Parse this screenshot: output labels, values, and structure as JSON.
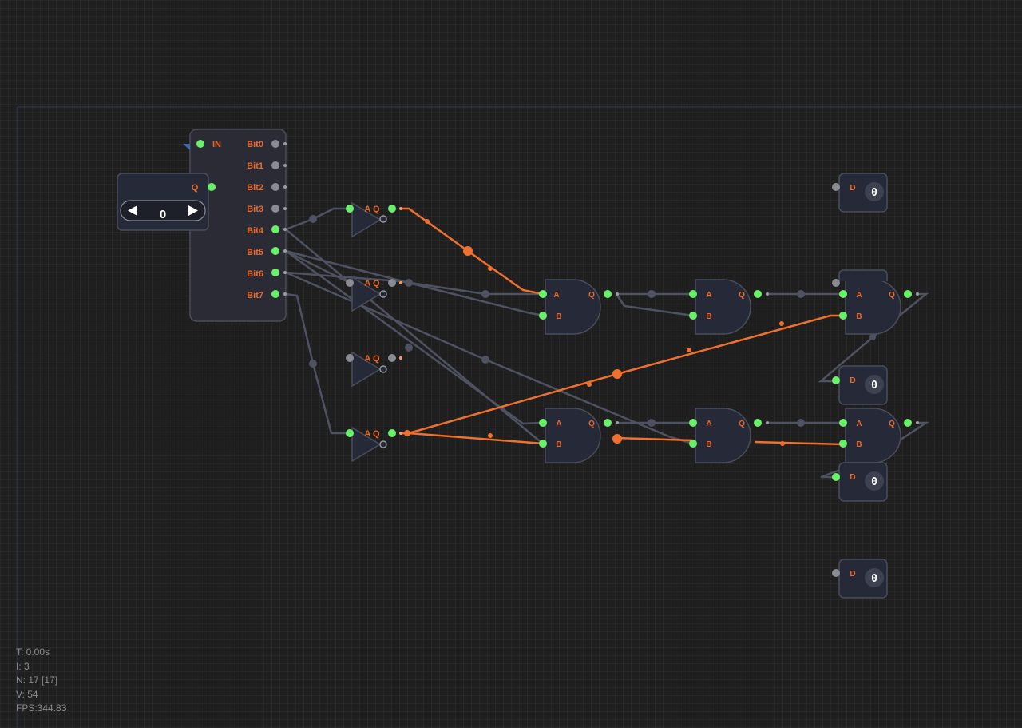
{
  "splitter": {
    "input_label": "IN",
    "outputs": [
      "Bit0",
      "Bit1",
      "Bit2",
      "Bit3",
      "Bit4",
      "Bit5",
      "Bit6",
      "Bit7"
    ]
  },
  "number_input": {
    "output_label": "Q",
    "value": "0"
  },
  "not_gates": [
    {
      "label": "A Q"
    },
    {
      "label": "A Q"
    },
    {
      "label": "A Q"
    },
    {
      "label": "A Q"
    }
  ],
  "and_gates": [
    {
      "a": "A",
      "b": "B",
      "q": "Q"
    },
    {
      "a": "A",
      "b": "B",
      "q": "Q"
    },
    {
      "a": "A",
      "b": "B",
      "q": "Q"
    },
    {
      "a": "A",
      "b": "B",
      "q": "Q"
    },
    {
      "a": "A",
      "b": "B",
      "q": "Q"
    },
    {
      "a": "A",
      "b": "B",
      "q": "Q"
    }
  ],
  "displays": [
    {
      "label": "D",
      "value": "0"
    },
    {
      "label": "D",
      "value": "0"
    },
    {
      "label": "D",
      "value": "0"
    },
    {
      "label": "D",
      "value": "0"
    }
  ],
  "stats": {
    "time": "T: 0.00s",
    "iterations": "I: 3",
    "nodes": "N: 17 [17]",
    "vertices": "V: 54",
    "fps": "FPS:344.83"
  },
  "colors": {
    "background": "#1f1f1f",
    "wire_active": "#f07030",
    "wire_inactive": "#4e5261",
    "pin_active": "#6bf06b",
    "label": "#e8692c"
  }
}
